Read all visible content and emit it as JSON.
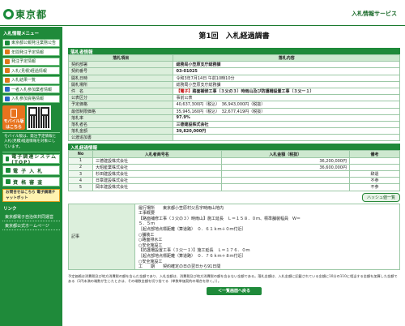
{
  "header": {
    "logo": "東京都",
    "service_title": "入札情報サービス"
  },
  "sidebar": {
    "menu_heading": "入札情報メニュー",
    "items": [
      {
        "label": "東京都公報発注業務公告"
      },
      {
        "label": "年間発注予定情報"
      },
      {
        "label": "発注予定情報"
      },
      {
        "label": "入札(見積)経過情報"
      },
      {
        "label": "入札結果一覧"
      },
      {
        "label": "一者入札参加業者情報"
      },
      {
        "label": "入札参加資格情報"
      }
    ],
    "mobile_label": "モバイル版",
    "mobile_sub": "はこちら",
    "note": "モバイル版は、発注予定情報と入札(見積)経過情報を対象にしています。",
    "big_items": [
      {
        "label": "電子調達システム(TOP)"
      },
      {
        "label": "電 子 入 札"
      },
      {
        "label": "資 格 審 査"
      }
    ],
    "banner": "お問合せはこちら 電子調達チャットボット",
    "link_heading": "リンク",
    "links": [
      {
        "label": "東京都電子自治体共同運営"
      },
      {
        "label": "東京都公式ホームページ"
      }
    ]
  },
  "main": {
    "page_title": "第1回　入札経過調書",
    "section1": "落札者情報",
    "info_header": {
      "item": "落札項目",
      "content": "落札内容"
    },
    "info_rows": [
      {
        "label": "契約部署",
        "value": "総務局小笠原支庁総務課",
        "bold": true
      },
      {
        "label": "契約番号",
        "value": "03-01025",
        "bold": true
      },
      {
        "label": "開札日時",
        "value": "令和3年7月14日 午前10時10分",
        "bold": false
      },
      {
        "label": "開札場所",
        "value": "総務局小笠原支庁総務課",
        "bold": false
      },
      {
        "label": "件　名",
        "tag": "【電子】",
        "value": "路面補修工事（３父の３）時雨山及び防護柵設置工事（３父ー１）",
        "bold": true
      },
      {
        "label": "公表区分",
        "value": "事前公表",
        "bold": false
      },
      {
        "label": "予定価格",
        "value": "40,637,300円（税込）　36,943,000円（税抜）",
        "bold": false
      },
      {
        "label": "最低制限価格",
        "value": "35,945,160円（税込）　32,677,419円（税抜）",
        "bold": false
      },
      {
        "label": "落札率",
        "value": "97.9%",
        "bold": true
      },
      {
        "label": "落札者名",
        "value": "三德建設株式会社",
        "bold": true
      },
      {
        "label": "落札金額",
        "value": "39,820,000円",
        "bold": true
      },
      {
        "label": "公渡追加書",
        "value": "",
        "bold": false
      }
    ],
    "section2": "入札経過情報",
    "bid_header": {
      "no": "No",
      "name": "入札者商号名",
      "amount": "入札金額（税抜）",
      "note": "備考"
    },
    "bids": [
      {
        "no": "1",
        "name": "三德建設株式会社",
        "amount": "36,200,000円",
        "note": ""
      },
      {
        "no": "2",
        "name": "大昭産業株式会社",
        "amount": "36,600,000円",
        "note": ""
      },
      {
        "no": "3",
        "name": "杉田建設株式会社",
        "amount": "",
        "note": "辞退"
      },
      {
        "no": "4",
        "name": "日章建設株式会社",
        "amount": "",
        "note": "不参"
      },
      {
        "no": "5",
        "name": "岡本建設株式会社",
        "amount": "",
        "note": "不参"
      }
    ],
    "pager_label": "ハッシュ値一覧",
    "remarks_label": "記事",
    "remarks_text": "履行場所　　東京都小笠原村父島字時雨山地内\n工事概要\n【路面補修工事（３父の３）時雨山】施工延長　Ｌ＝１５８．０ｍ、標準舗装幅員　Ｗ＝\n５．５ｍ\n［起点部地点標距離（算道路）　０．６１ｋｍ＋０ｍ付近］\n○舗装工\n○路面排水工\n○安全施設工\n【防護柵設置工事（３父ー１）】施工延長　Ｌ＝１７６．０ｍ\n［起点部地点標距離（算道路）　０．７６ｋｍ＋８ｍ付近］\n○安全施設工\n工　　期　　契約確定の日の翌日から91日間",
    "footnote": "予定価格は消費税及び地方消費税の額を含んだ金額であり、入札金額は、消費税及び地方消費税の額を含まない金額である。落札金額は、入札金額に記載されている金額に10分の110に相当する金額を加算した金額である（1円未満の端数が生じたときは、その端数金額を切り捨てる（単数単価契約の場合を除く。））。",
    "back_button": "＜一覧画面へ戻る"
  },
  "colors": {
    "primary_green": "#1f8a3a",
    "header_cell": "#dcefdc",
    "accent_red": "#c00000",
    "mobile_orange": "#e8731e"
  }
}
